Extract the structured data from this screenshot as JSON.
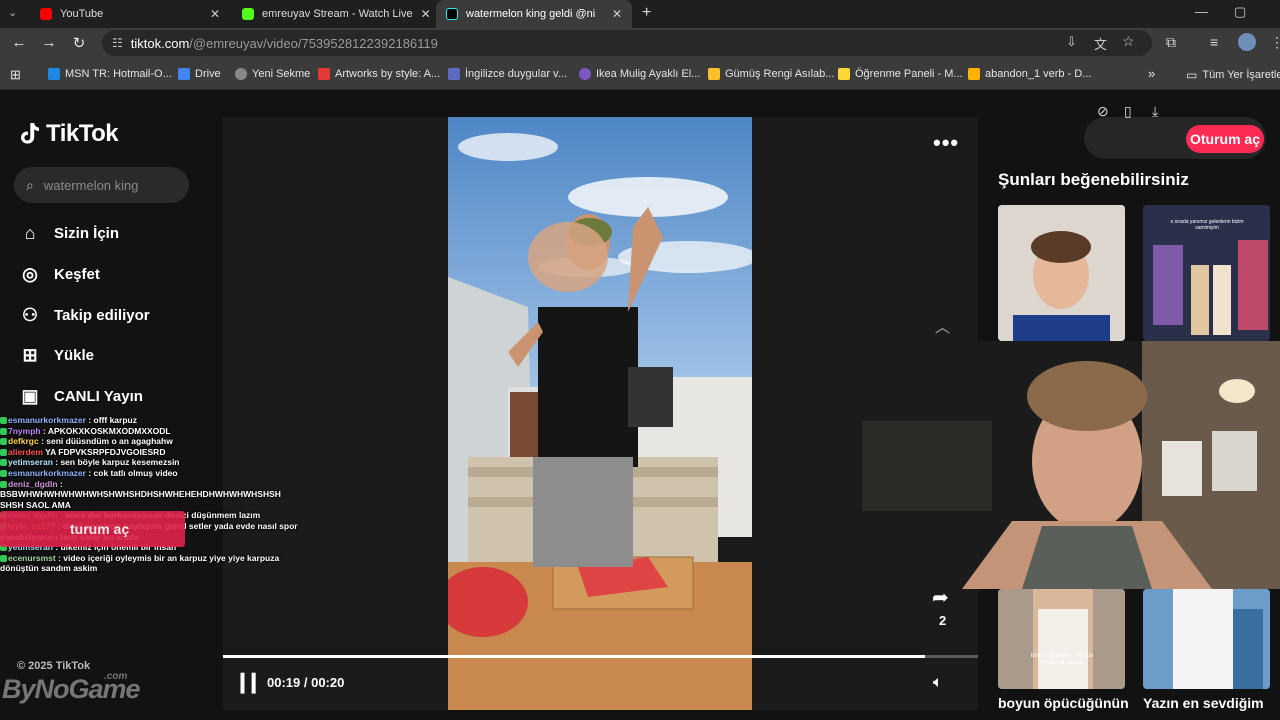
{
  "tabs": [
    {
      "label": "YouTube",
      "color": "#ff0000"
    },
    {
      "label": "emreuyav Stream - Watch Live",
      "color": "#53fc18"
    },
    {
      "label": "watermelon king geldi @ni",
      "color": "#000000"
    }
  ],
  "omnibox": {
    "host": "tiktok.com",
    "path": "/@emreuyav/video/7539528122392186119"
  },
  "bookmarks": [
    {
      "label": "MSN TR: Hotmail-O...",
      "color": "#1e88e5"
    },
    {
      "label": "Drive",
      "color": "#4285f4"
    },
    {
      "label": "Yeni Sekme",
      "color": "#888888"
    },
    {
      "label": "Artworks by style: A...",
      "color": "#e53935"
    },
    {
      "label": "İngilizce duygular v...",
      "color": "#5c6bc0"
    },
    {
      "label": "Ikea Mulig Ayaklı El...",
      "color": "#7e57c2"
    },
    {
      "label": "Gümüş Rengi Asılab...",
      "color": "#fbc02d"
    },
    {
      "label": "Öğrenme Paneli - M...",
      "color": "#fdd835"
    },
    {
      "label": "abandon_1 verb - D...",
      "color": "#ffb300"
    }
  ],
  "bookmarks_other": "Tüm Yer İşaretle",
  "brand": "TikTok",
  "search_placeholder": "watermelon king",
  "nav": [
    {
      "label": "Sizin İçin",
      "icon": "home-icon"
    },
    {
      "label": "Keşfet",
      "icon": "compass-icon"
    },
    {
      "label": "Takip ediliyor",
      "icon": "following-icon"
    },
    {
      "label": "Yükle",
      "icon": "upload-icon"
    },
    {
      "label": "CANLI Yayın",
      "icon": "live-icon"
    }
  ],
  "player": {
    "time": "00:19 / 00:20",
    "progress": 0.93,
    "share_count": "2"
  },
  "login_label": "Oturum aç",
  "overlay_login_label": "turum aç",
  "suggest_title": "Şunları beğenebilirsiniz",
  "suggest_captions": [
    "boyun öpücüğünün",
    "Yazın en sevdiğim"
  ],
  "thumb_text": {
    "t2": "o sırada yanımız gelenlerin bizim samimiyim",
    "t3": "boyun öpücüğü sonrası konuşma çabası"
  },
  "chat": [
    {
      "user": "esmanurkorkmazer",
      "text": ": offf karpuz",
      "ucolor": "#8fb4ff"
    },
    {
      "user": "7nymph",
      "text": ": APKOKXKOSKMXODMXXODL",
      "ucolor": "#bb86fc"
    },
    {
      "user": "defkrgc",
      "text": ": seni düüsndüm o an agaghahw",
      "ucolor": "#ffd54f"
    },
    {
      "user": "alierdem",
      "text": "YA FDPVKSRPFDJVGOIESRD",
      "ucolor": "#ff5252"
    },
    {
      "user": "yetimseran",
      "text": ": sen böyle karpuz kesemezsin",
      "ucolor": "#b3e5fc"
    },
    {
      "user": "esmanurkorkmazer",
      "text": ": cok tatlı olmuş video",
      "ucolor": "#8fb4ff"
    },
    {
      "user": "deniz_dgdln",
      "text": ":",
      "ucolor": "#ce93d8"
    },
    {
      "user": "",
      "text": "BSBWHWHWHWHWHWHSHWHSHDHSHWHEHEHDHWHWHWHSHSH",
      "ucolor": "#ffffff"
    },
    {
      "user": "",
      "text": "SHSH SAOL AMA",
      "ucolor": "#ffffff"
    },
    {
      "user": "deniz_dgdln",
      "text": ": emre dur korkamıyorum denizi düşünmem lazım",
      "ucolor": "#ce93d8"
    },
    {
      "user": "leyla_nz177",
      "text": ": dimil porsiyon paylaşımı genel setler yada evde nasıl spor",
      "ucolor": "#ffb74d"
    },
    {
      "user": "",
      "text": "yapabiliyorum tarzı sarar bu arada",
      "ucolor": "#ffffff"
    },
    {
      "user": "yetimseran",
      "text": ": ülkemiz için önemli bir insan",
      "ucolor": "#b3e5fc"
    },
    {
      "user": "ecenursmst",
      "text": ": video içeriği oyleymis bir an karpuz yiye yiye karpuza",
      "ucolor": "#a5d6a7"
    },
    {
      "user": "",
      "text": "dönüştün sandım askim",
      "ucolor": "#ffffff"
    }
  ],
  "copyright": "© 2025 TikTok",
  "watermark": "ByNoGame",
  "watermark_suffix": ".com",
  "colors": {
    "accent": "#fe2c55",
    "page_bg": "#121212"
  }
}
